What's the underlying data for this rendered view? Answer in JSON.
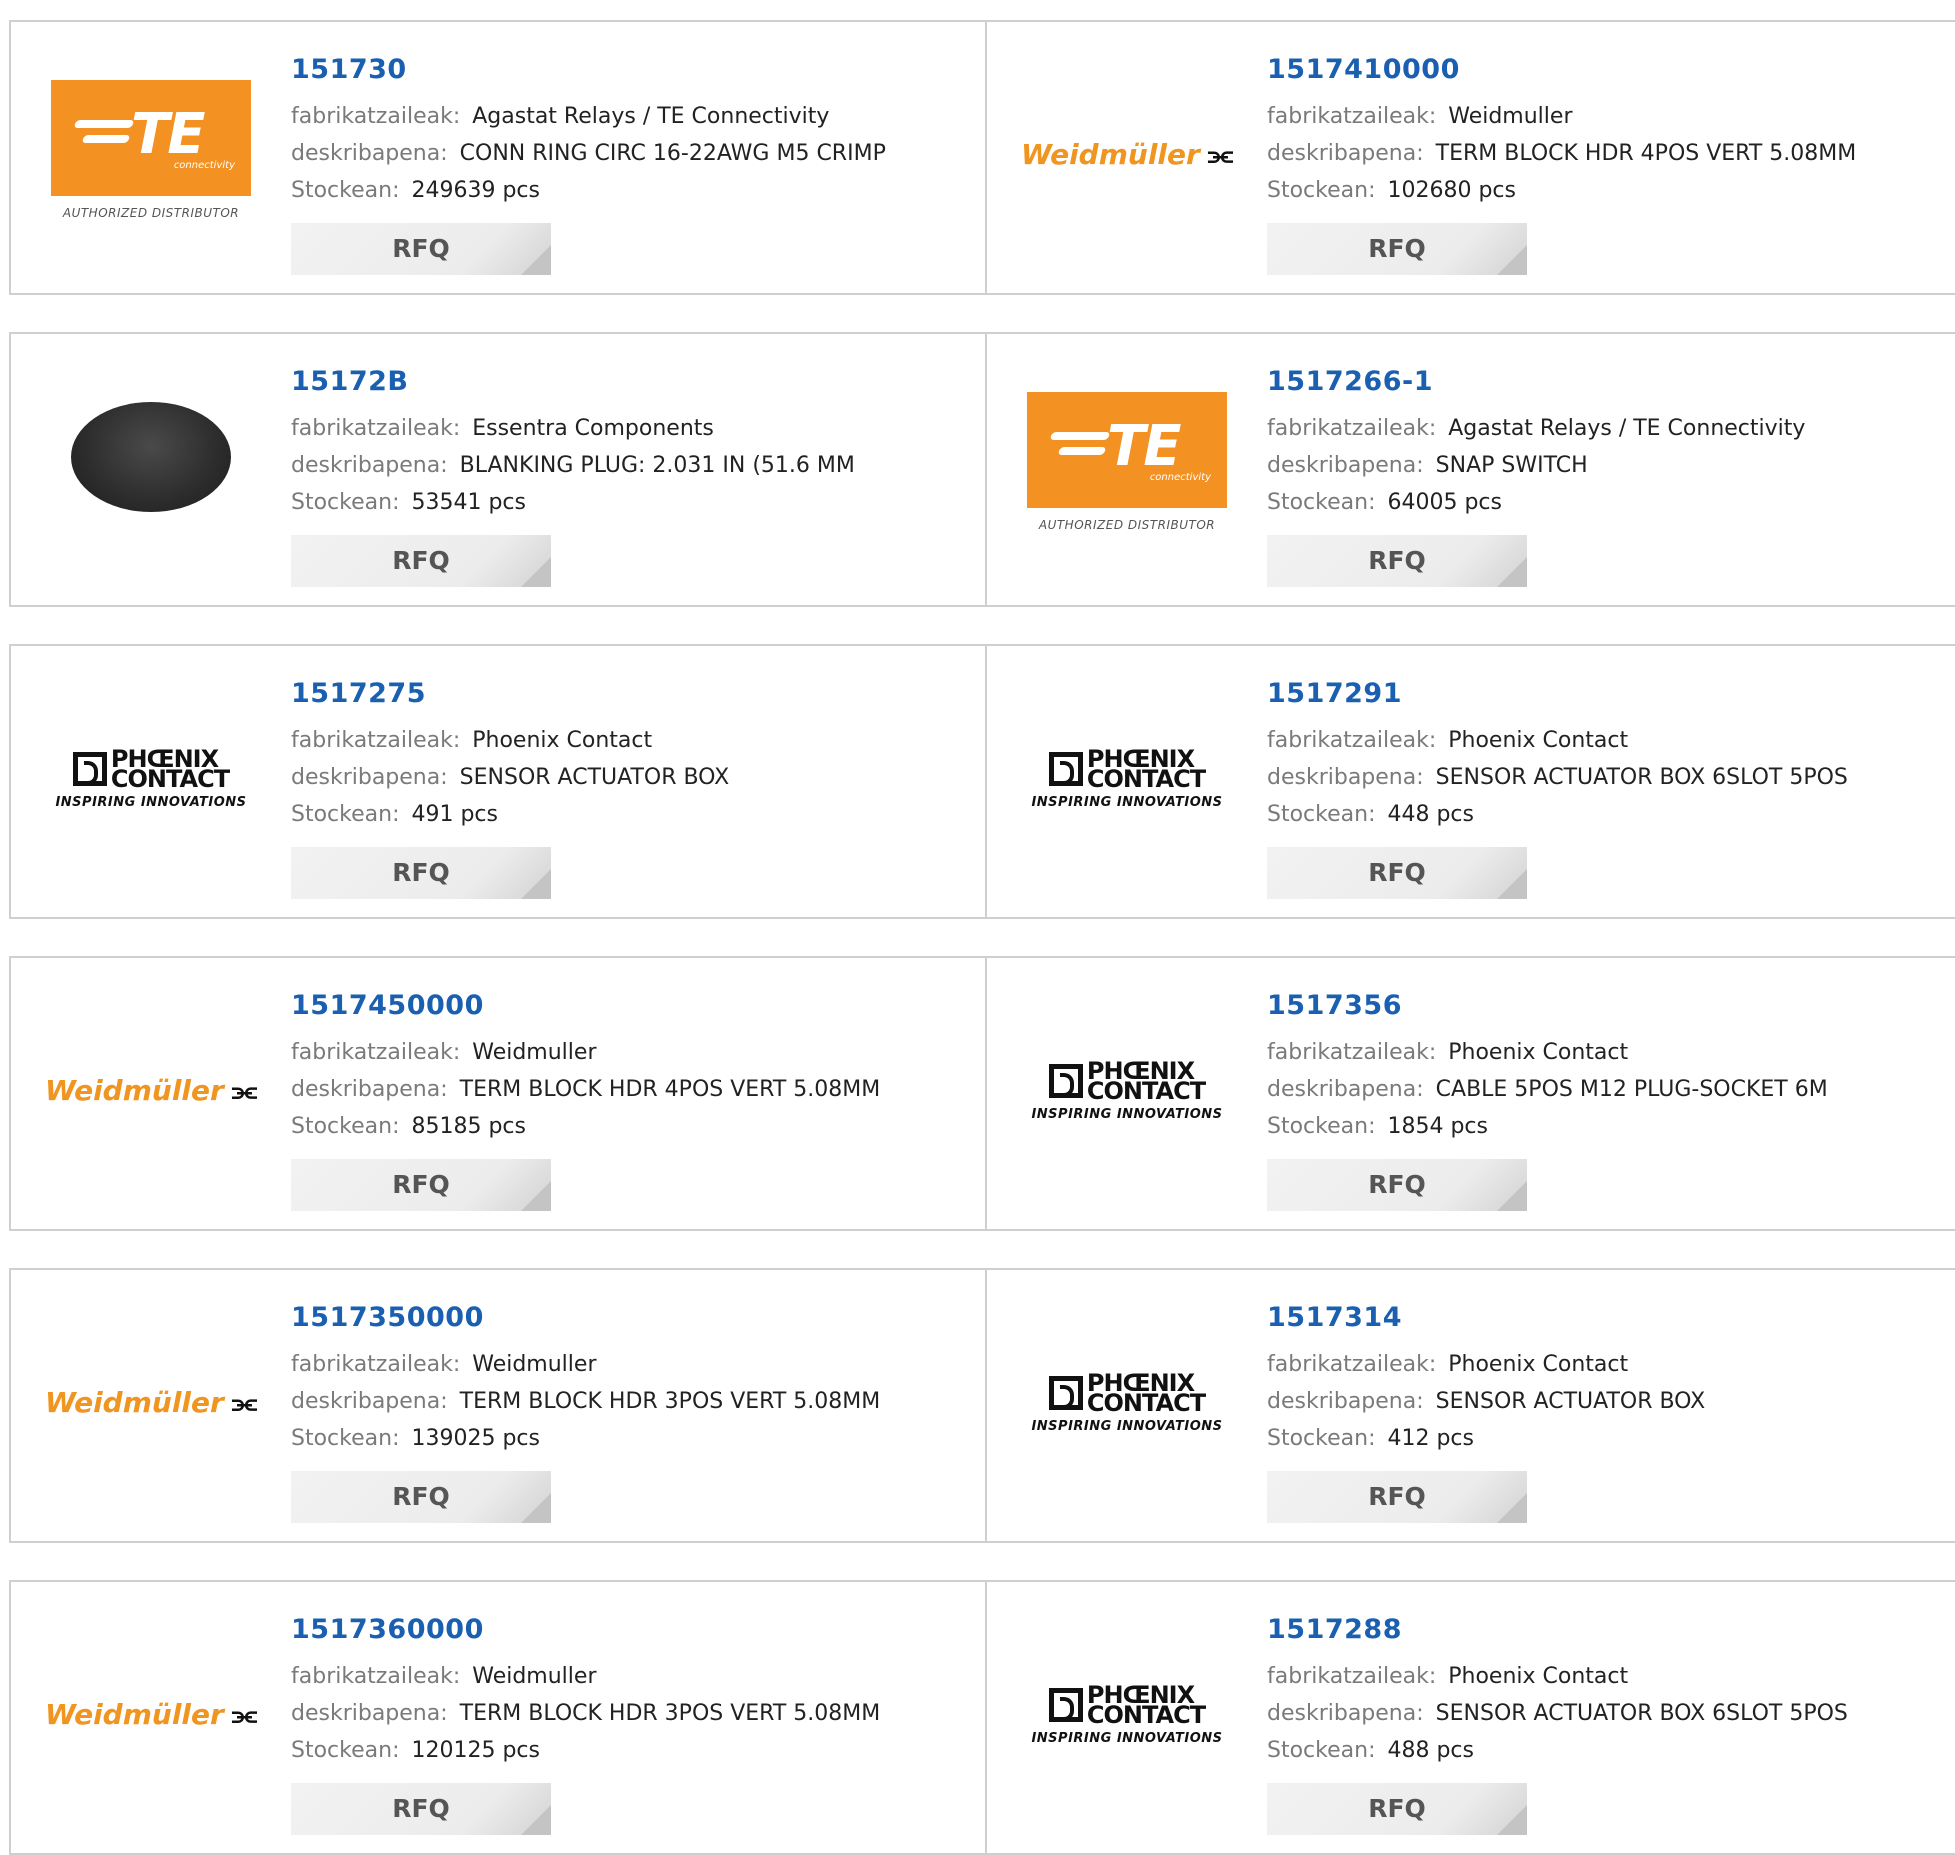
{
  "labels": {
    "manufacturer": "fabrikatzaileak:",
    "description": "deskribapena:",
    "stock": "Stockean:",
    "rfq": "RFQ"
  },
  "brands": {
    "te": {
      "text": "TE",
      "sub": "connectivity",
      "authorized": "AUTHORIZED DISTRIBUTOR",
      "color": "#f39223"
    },
    "weidmuller": {
      "text": "Weidmüller",
      "mark": "ⵉ",
      "color": "#f0951f"
    },
    "phoenix": {
      "line1": "PHŒNIX",
      "line2": "CONTACT",
      "tag": "INSPIRING INNOVATIONS"
    }
  },
  "products": [
    {
      "part": "151730",
      "manufacturer": "Agastat Relays / TE Connectivity",
      "description": "CONN RING CIRC 16-22AWG M5 CRIMP",
      "stock": "249639 pcs",
      "logo": "te"
    },
    {
      "part": "1517410000",
      "manufacturer": "Weidmuller",
      "description": "TERM BLOCK HDR 4POS VERT 5.08MM",
      "stock": "102680 pcs",
      "logo": "weidmuller"
    },
    {
      "part": "15172B",
      "manufacturer": "Essentra Components",
      "description": "BLANKING PLUG: 2.031 IN (51.6 MM",
      "stock": "53541 pcs",
      "logo": "plug"
    },
    {
      "part": "1517266-1",
      "manufacturer": "Agastat Relays / TE Connectivity",
      "description": "SNAP SWITCH",
      "stock": "64005 pcs",
      "logo": "te"
    },
    {
      "part": "1517275",
      "manufacturer": "Phoenix Contact",
      "description": "SENSOR ACTUATOR BOX",
      "stock": "491 pcs",
      "logo": "phoenix"
    },
    {
      "part": "1517291",
      "manufacturer": "Phoenix Contact",
      "description": "SENSOR ACTUATOR BOX 6SLOT 5POS",
      "stock": "448 pcs",
      "logo": "phoenix"
    },
    {
      "part": "1517450000",
      "manufacturer": "Weidmuller",
      "description": "TERM BLOCK HDR 4POS VERT 5.08MM",
      "stock": "85185 pcs",
      "logo": "weidmuller"
    },
    {
      "part": "1517356",
      "manufacturer": "Phoenix Contact",
      "description": "CABLE 5POS M12 PLUG-SOCKET 6M",
      "stock": "1854 pcs",
      "logo": "phoenix"
    },
    {
      "part": "1517350000",
      "manufacturer": "Weidmuller",
      "description": "TERM BLOCK HDR 3POS VERT 5.08MM",
      "stock": "139025 pcs",
      "logo": "weidmuller"
    },
    {
      "part": "1517314",
      "manufacturer": "Phoenix Contact",
      "description": "SENSOR ACTUATOR BOX",
      "stock": "412 pcs",
      "logo": "phoenix"
    },
    {
      "part": "1517360000",
      "manufacturer": "Weidmuller",
      "description": "TERM BLOCK HDR 3POS VERT 5.08MM",
      "stock": "120125 pcs",
      "logo": "weidmuller"
    },
    {
      "part": "1517288",
      "manufacturer": "Phoenix Contact",
      "description": "SENSOR ACTUATOR BOX 6SLOT 5POS",
      "stock": "488 pcs",
      "logo": "phoenix"
    }
  ]
}
